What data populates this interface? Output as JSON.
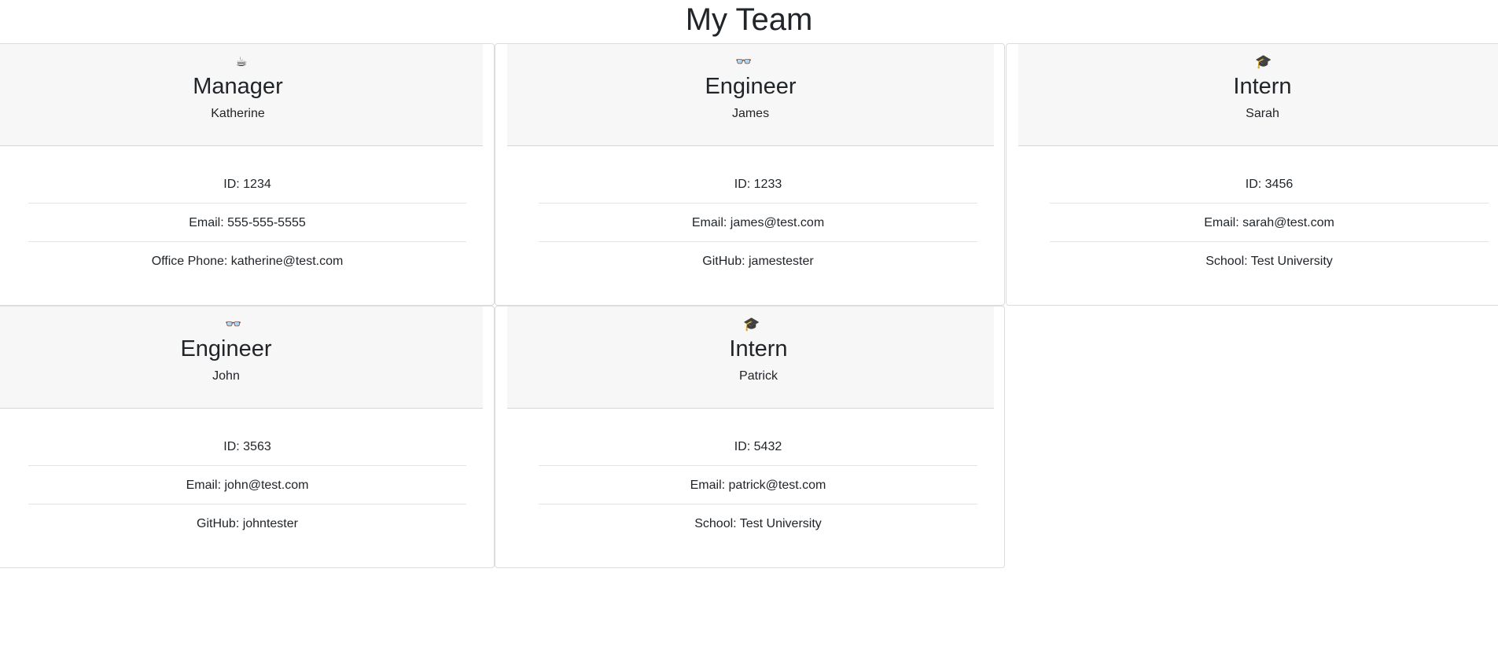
{
  "page": {
    "title": "My Team"
  },
  "employees": [
    {
      "role": "Manager",
      "icon": "☕",
      "icon_name": "coffee-icon",
      "name": "Katherine",
      "details": [
        "ID: 1234",
        "Email: 555-555-5555",
        "Office Phone: katherine@test.com"
      ]
    },
    {
      "role": "Engineer",
      "icon": "👓",
      "icon_name": "glasses-icon",
      "name": "James",
      "details": [
        "ID: 1233",
        "Email: james@test.com",
        "GitHub: jamestester"
      ]
    },
    {
      "role": "Intern",
      "icon": "🎓",
      "icon_name": "graduation-cap-icon",
      "name": "Sarah",
      "details": [
        "ID: 3456",
        "Email: sarah@test.com",
        "School: Test University"
      ]
    },
    {
      "role": "Engineer",
      "icon": "👓",
      "icon_name": "glasses-icon",
      "name": "John",
      "details": [
        "ID: 3563",
        "Email: john@test.com",
        "GitHub: johntester"
      ]
    },
    {
      "role": "Intern",
      "icon": "🎓",
      "icon_name": "graduation-cap-icon",
      "name": "Patrick",
      "details": [
        "ID: 5432",
        "Email: patrick@test.com",
        "School: Test University"
      ]
    }
  ]
}
